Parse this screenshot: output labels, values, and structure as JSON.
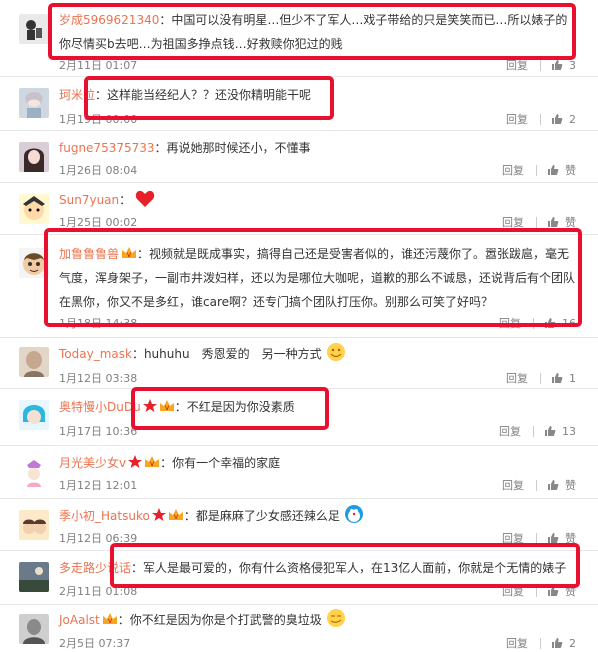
{
  "labels": {
    "reply": "回复",
    "like": "赞"
  },
  "comments": [
    {
      "user": "岁成5969621340",
      "text": "：中国可以没有明星…但少不了军人…戏子带给的只是笑笑而已…所以婊子的你尽情买b去吧…为祖国多挣点钱…好救赎你犯过的贱",
      "time": "2月11日 01:07",
      "likes": "3"
    },
    {
      "user": "珂米拉",
      "text": "：这样能当经纪人？？还没你精明能干呢",
      "time": "1月19日 00:00",
      "likes": "2"
    },
    {
      "user": "fugne75375733",
      "text": "：再说她那时候还小，不懂事",
      "time": "1月26日 08:04",
      "likes": "赞"
    },
    {
      "user": "Sun7yuan",
      "text": "：",
      "time": "1月25日 00:02",
      "likes": "赞"
    },
    {
      "user": "加鲁鲁鲁兽",
      "text": "：视频就是既成事实，搞得自己还是受害者似的，谁还污蔑你了。嚣张跋扈，毫无气度，浑身架子，一副市井泼妇样，还以为是哪位大咖呢，道歉的那么不诚恳，还说背后有个团队在黑你，你又不是多红，谁care啊？还专门搞个团队打压你。别那么可笑了好吗？",
      "time": "1月18日 14:38",
      "likes": "16"
    },
    {
      "user": "Today_mask",
      "text": "：huhuhu　秀恩爱的　另一种方式",
      "time": "1月12日 03:38",
      "likes": "1"
    },
    {
      "user": "奥特慢小DuDu",
      "text": "：不红是因为你没素质",
      "time": "1月17日 10:36",
      "likes": "13"
    },
    {
      "user": "月光美少女v",
      "text": "：你有一个幸福的家庭",
      "time": "1月12日 12:01",
      "likes": "赞"
    },
    {
      "user": "季小初_Hatsuko",
      "text": "：都是麻麻了少女感还辣么足",
      "time": "1月12日 06:39",
      "likes": "赞"
    },
    {
      "user": "多走路少说话",
      "text": "：军人是最可爱的，你有什么资格侵犯军人，在13亿人面前，你就是个无情的婊子",
      "time": "2月11日 01:08",
      "likes": "赞"
    },
    {
      "user": "JoAalst",
      "text": "：你不红是因为你是个打武警的臭垃圾",
      "time": "2月5日 07:37",
      "likes": "2"
    }
  ],
  "colors": {
    "username": "#eb7350",
    "highlight": "#e8102e",
    "meta": "#808080"
  }
}
